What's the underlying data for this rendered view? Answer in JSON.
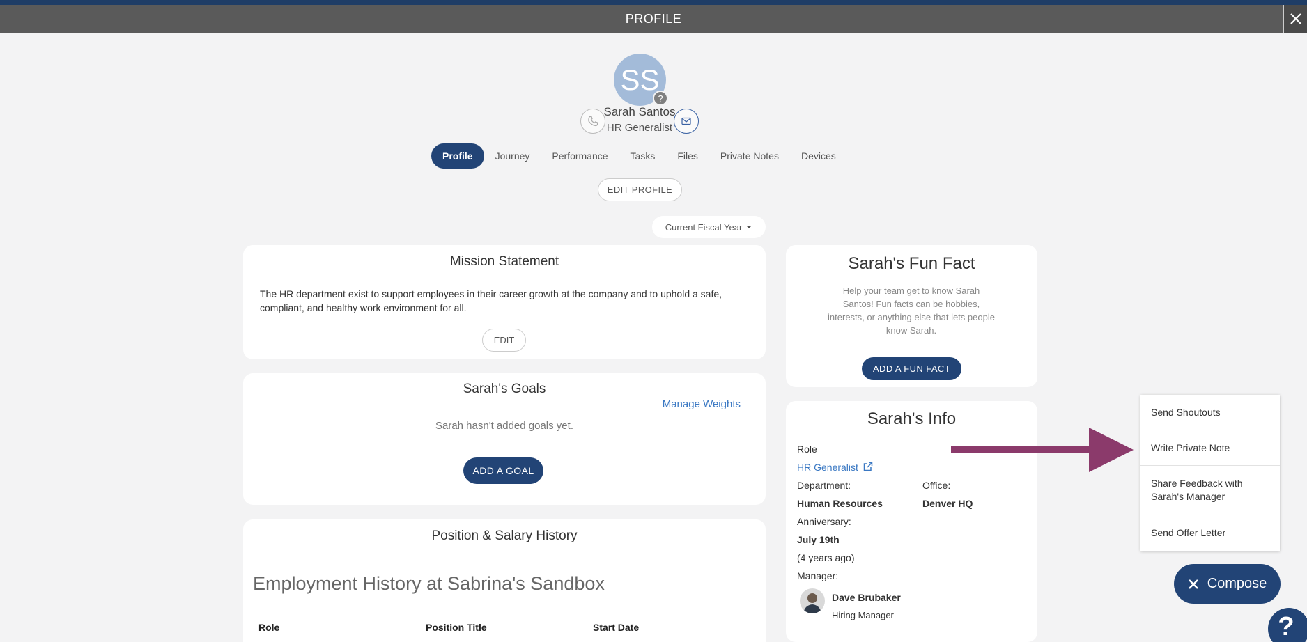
{
  "header": {
    "title": "PROFILE",
    "close_icon": "close-icon"
  },
  "profile": {
    "initials": "SS",
    "badge": "?",
    "name": "Sarah Santos",
    "role": "HR Generalist",
    "avatar_color": "#a3bbd9"
  },
  "tabs": [
    {
      "label": "Profile",
      "active": true
    },
    {
      "label": "Journey"
    },
    {
      "label": "Performance"
    },
    {
      "label": "Tasks"
    },
    {
      "label": "Files"
    },
    {
      "label": "Private Notes"
    },
    {
      "label": "Devices"
    }
  ],
  "edit_profile_label": "EDIT PROFILE",
  "fiscal_selector": {
    "selected": "Current Fiscal Year"
  },
  "mission": {
    "title": "Mission Statement",
    "text": "The HR department exist to support employees in their career growth at the company and to uphold a safe, compliant, and healthy work environment for all.",
    "edit_label": "EDIT"
  },
  "goals": {
    "title": "Sarah's Goals",
    "manage_weights": "Manage Weights",
    "empty_text": "Sarah hasn't added goals yet.",
    "add_label": "ADD A GOAL"
  },
  "position_history": {
    "title": "Position & Salary History",
    "heading": "Employment History at Sabrina's Sandbox",
    "columns": [
      "Role",
      "Position Title",
      "Start Date"
    ]
  },
  "fun_fact": {
    "title": "Sarah's Fun Fact",
    "text": "Help your team get to know Sarah Santos! Fun facts can be hobbies, interests, or anything else that lets people know Sarah.",
    "add_label": "ADD A FUN FACT"
  },
  "info": {
    "title": "Sarah's Info",
    "role_label": "Role",
    "role_value": "HR Generalist",
    "department_label": "Department:",
    "department_value": "Human Resources",
    "office_label": "Office:",
    "office_value": "Denver HQ",
    "anniversary_label": "Anniversary:",
    "anniversary_value": "July 19th",
    "anniversary_ago": "(4 years ago)",
    "manager_label": "Manager:",
    "manager_name": "Dave Brubaker",
    "manager_title": "Hiring Manager"
  },
  "compose_menu": {
    "items": [
      "Send Shoutouts",
      "Write Private Note",
      "Share Feedback with Sarah's Manager",
      "Send Offer Letter"
    ]
  },
  "compose_button": {
    "label": "Compose"
  },
  "help_button": {
    "label": "?"
  },
  "colors": {
    "navy": "#224476",
    "link": "#3a78c3",
    "arrow": "#8b3a6b",
    "header": "#5a5a5a"
  }
}
